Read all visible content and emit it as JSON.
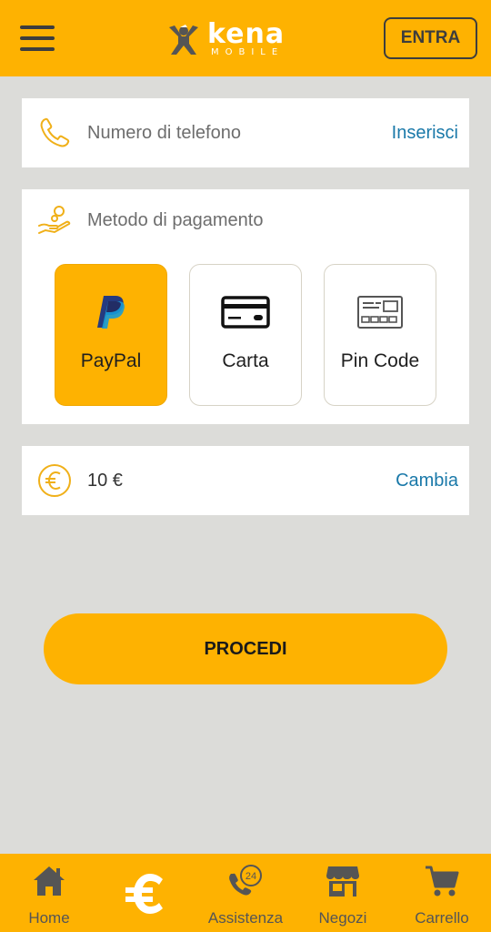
{
  "header": {
    "logo_text": "kena",
    "logo_sub": "MOBILE",
    "login_label": "ENTRA"
  },
  "phone": {
    "placeholder": "Numero di telefono",
    "action": "Inserisci"
  },
  "payment": {
    "title": "Metodo di pagamento",
    "options": [
      {
        "label": "PayPal",
        "icon": "paypal-icon",
        "selected": true
      },
      {
        "label": "Carta",
        "icon": "credit-card-icon",
        "selected": false
      },
      {
        "label": "Pin Code",
        "icon": "pin-code-card-icon",
        "selected": false
      }
    ]
  },
  "amount": {
    "value": "10 €",
    "action": "Cambia"
  },
  "proceed_label": "PROCEDI",
  "nav": [
    {
      "label": "Home",
      "icon": "home-icon"
    },
    {
      "label": "",
      "icon": "euro-icon"
    },
    {
      "label": "Assistenza",
      "icon": "phone-24-icon",
      "badge": "24"
    },
    {
      "label": "Negozi",
      "icon": "store-icon"
    },
    {
      "label": "Carrello",
      "icon": "cart-icon"
    }
  ],
  "colors": {
    "brand_yellow": "#feb201",
    "link_blue": "#1a79a9",
    "background": "#dcdcd9"
  }
}
